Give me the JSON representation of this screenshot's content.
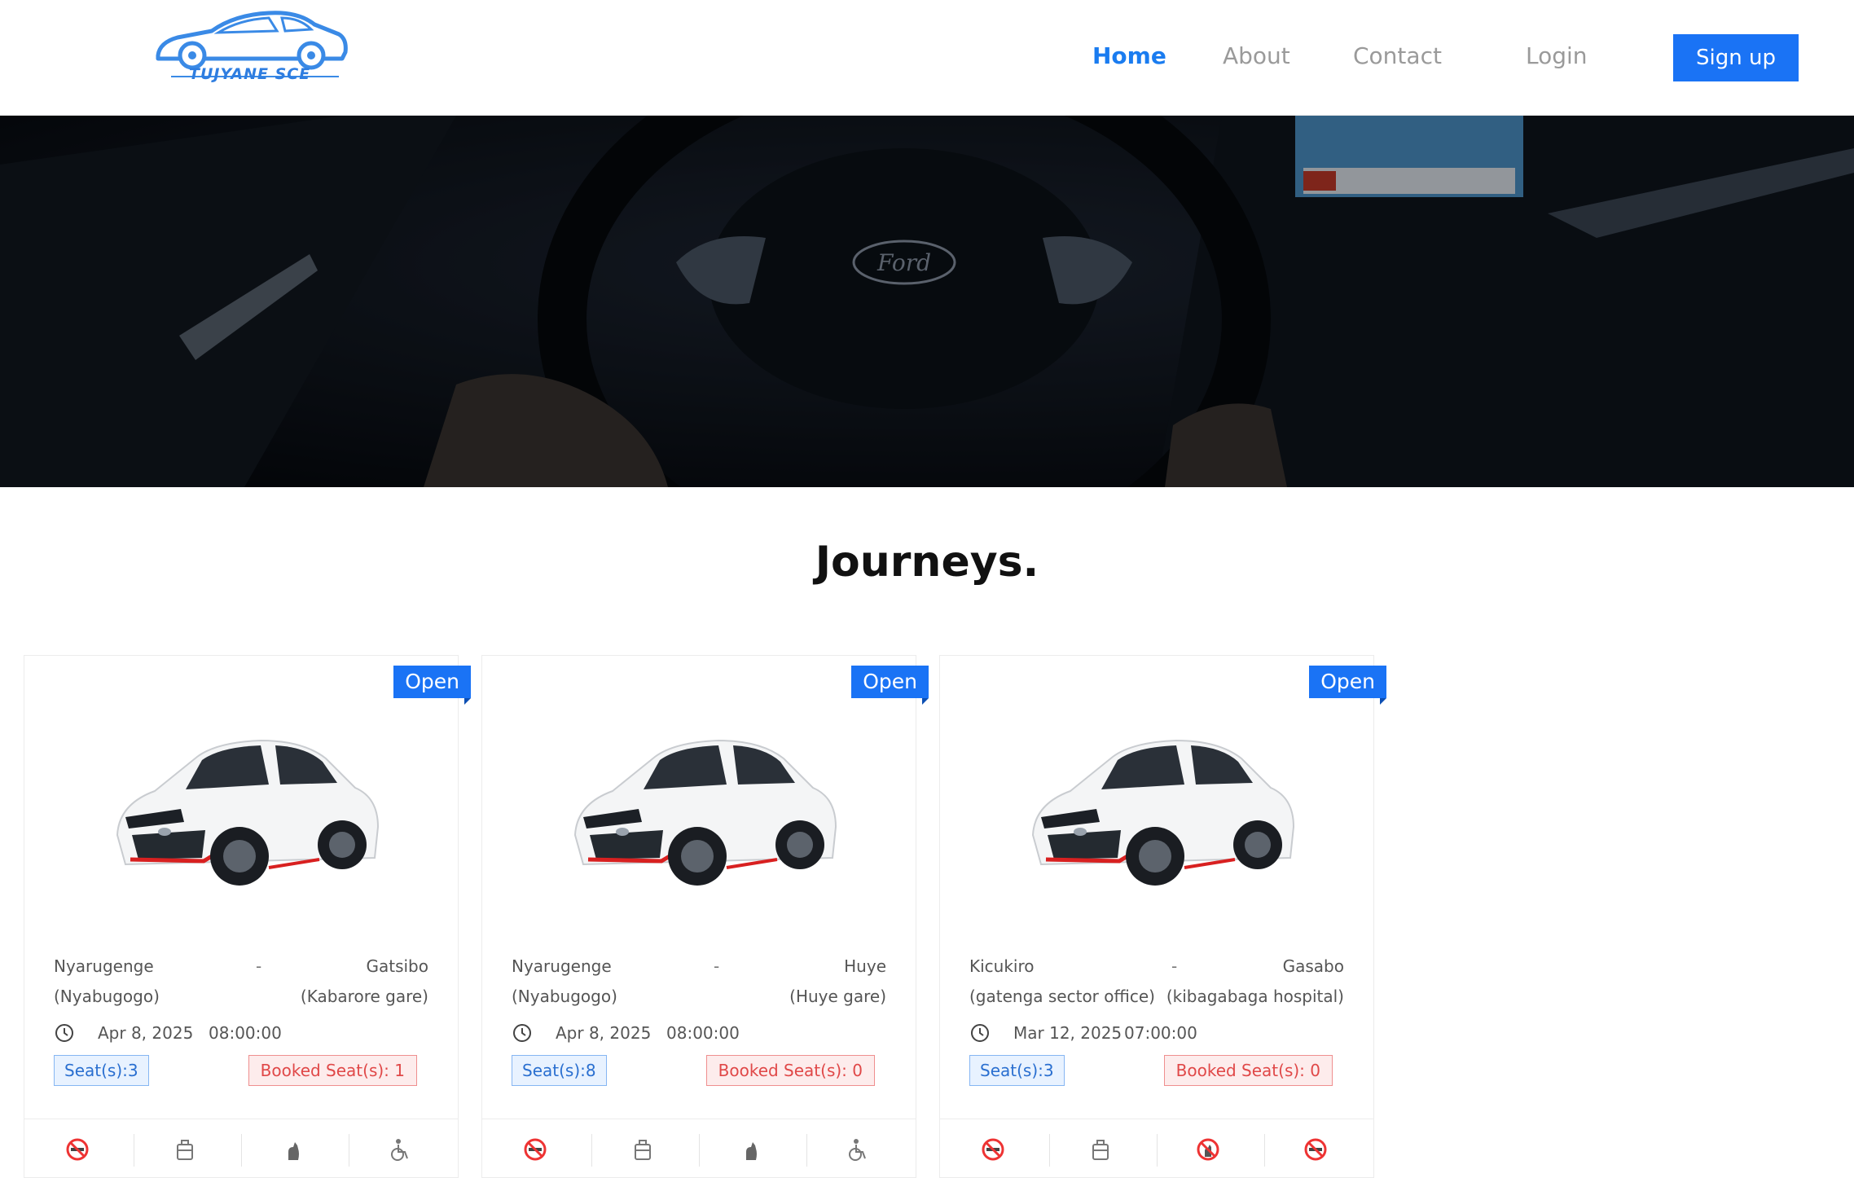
{
  "header": {
    "logo_text": "TUJYANE SCE",
    "nav": [
      {
        "label": "Home",
        "active": true
      },
      {
        "label": "About",
        "active": false
      },
      {
        "label": "Contact",
        "active": false
      }
    ],
    "login_label": "Login",
    "signup_label": "Sign up"
  },
  "hero": {
    "image": "car-interior-steering-wheel",
    "brand_emblem": "Ford"
  },
  "main": {
    "title": "Journeys.",
    "cards": [
      {
        "status": "Open",
        "from": "Nyarugenge",
        "from_detail": "(Nyabugogo)",
        "to": "Gatsibo",
        "to_detail": "(Kabarore gare)",
        "separator": "-",
        "date": "Apr 8, 2025",
        "time": "08:00:00",
        "seats": "Seat(s):3",
        "booked": "Booked Seat(s): 1",
        "features": [
          "no-smoking-icon",
          "luggage-icon",
          "pet-icon",
          "wheelchair-icon"
        ]
      },
      {
        "status": "Open",
        "from": "Nyarugenge",
        "from_detail": "(Nyabugogo)",
        "to": "Huye",
        "to_detail": "(Huye gare)",
        "separator": "-",
        "date": "Apr 8, 2025",
        "time": "08:00:00",
        "seats": "Seat(s):8",
        "booked": "Booked Seat(s): 0",
        "features": [
          "no-smoking-icon",
          "luggage-icon",
          "pet-icon",
          "wheelchair-icon"
        ]
      },
      {
        "status": "Open",
        "from": "Kicukiro",
        "from_detail": "(gatenga sector office)",
        "to": "Gasabo",
        "to_detail": "(kibagabaga hospital)",
        "separator": "-",
        "date": "Mar 12, 2025",
        "time": "07:00:00",
        "seats": "Seat(s):3",
        "booked": "Booked Seat(s): 0",
        "features": [
          "no-smoking-icon",
          "luggage-icon",
          "no-pets-icon",
          "no-smoking-icon"
        ]
      }
    ]
  },
  "colors": {
    "accent": "#1a73f5",
    "booked_red": "#e04848",
    "hero_dark": "#0b1018"
  }
}
